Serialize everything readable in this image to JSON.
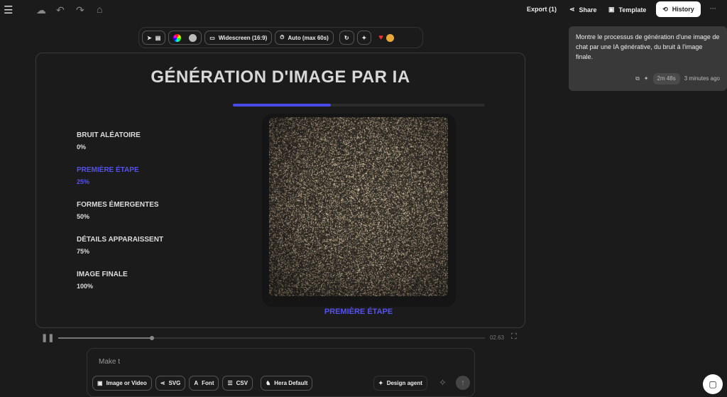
{
  "topbar": {
    "export": "Export (1)",
    "share": "Share",
    "template": "Template",
    "history": "History",
    "more": "···"
  },
  "toolbar": {
    "aspect": "Widescreen (16:9)",
    "duration": "Auto (max 60s)"
  },
  "stage": {
    "title": "GÉNÉRATION D'IMAGE PAR IA",
    "progress": 0.39,
    "caption": "PREMIÈRE ÉTAPE",
    "steps": [
      {
        "label": "BRUIT ALÉATOIRE",
        "pct": "0%"
      },
      {
        "label": "PREMIÈRE ÉTAPE",
        "pct": "25%"
      },
      {
        "label": "FORMES ÉMERGENTES",
        "pct": "50%"
      },
      {
        "label": "DÉTAILS APPARAISSENT",
        "pct": "75%"
      },
      {
        "label": "IMAGE FINALE",
        "pct": "100%"
      }
    ],
    "active_step": 1
  },
  "playback": {
    "time": "02.63",
    "position": 0.22
  },
  "prompt": {
    "value": "Make t",
    "buttons": [
      "Image or Video",
      "SVG",
      "Font",
      "CSV",
      "Hera Default"
    ],
    "agent": "Design agent"
  },
  "chat": {
    "message": "Montre le processus de génération d'une image de chat par une IA générative, du bruit à l'image finale.",
    "duration": "2m 48s",
    "time": "3 minutes ago"
  },
  "colors": {
    "accent": "#4a4be6",
    "bg": "#1b1b1b"
  }
}
